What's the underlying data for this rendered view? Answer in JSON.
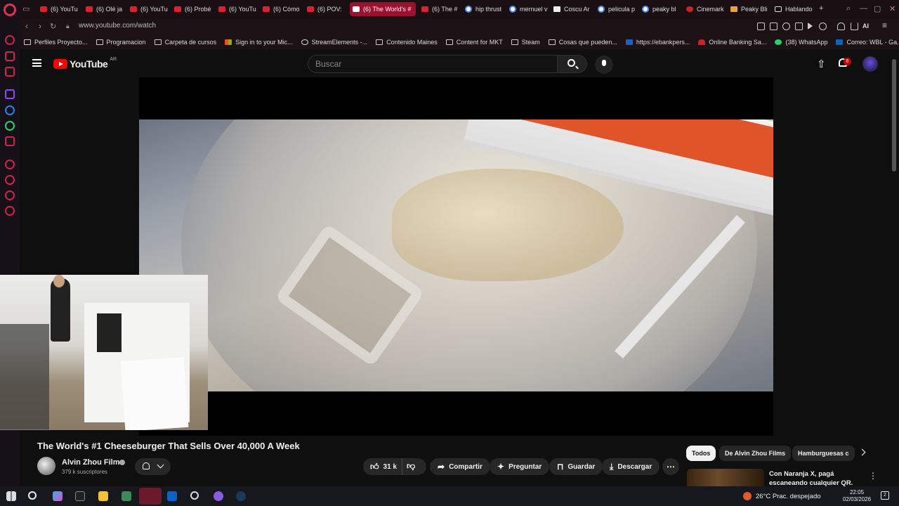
{
  "browser": {
    "tabs": [
      {
        "label": "(6) YouTu",
        "icon": "youtube-icon"
      },
      {
        "label": "(6) Olé ja",
        "icon": "youtube-icon"
      },
      {
        "label": "(6) YouTu",
        "icon": "youtube-icon"
      },
      {
        "label": "(6) Probé",
        "icon": "youtube-icon"
      },
      {
        "label": "(6) YouTu",
        "icon": "youtube-icon"
      },
      {
        "label": "(6) Cómo",
        "icon": "youtube-icon"
      },
      {
        "label": "(6) POV:",
        "icon": "youtube-icon"
      },
      {
        "label": "(6) The World's #",
        "icon": "youtube-icon",
        "active": true
      },
      {
        "label": "(6) The #",
        "icon": "youtube-icon"
      },
      {
        "label": "hip thrust",
        "icon": "google-icon"
      },
      {
        "label": "mernuel v",
        "icon": "google-icon"
      },
      {
        "label": "Coscu Ar",
        "icon": "wikipedia-icon"
      },
      {
        "label": "pelicula p",
        "icon": "google-icon"
      },
      {
        "label": "peaky bl",
        "icon": "google-icon"
      },
      {
        "label": "Cinemark",
        "icon": "cinemark-icon"
      },
      {
        "label": "Peaky Bli",
        "icon": "page-icon"
      },
      {
        "label": "Hablando",
        "icon": "tiktok-icon"
      }
    ],
    "url": "www.youtube.com/watch",
    "bookmarks": [
      "Perfiles Proyecto...",
      "Programacion",
      "Carpeta de cursos",
      "Sign in to your Mic...",
      "StreamElements -...",
      "Contenido Maines",
      "Content for MKT",
      "Steam",
      "Cosas que pueden...",
      "https://ebankpers...",
      "Online Banking Sa...",
      "(38) WhatsApp",
      "Correo: WBL - Ga..."
    ],
    "ai_label": "AI"
  },
  "youtube": {
    "logo_text": "YouTube",
    "country_code": "AR",
    "search_placeholder": "Buscar",
    "notification_count": "6",
    "video": {
      "title": "The World's #1 Cheeseburger That Sells Over 40,000 A Week",
      "channel": "Alvin Zhou Films",
      "subscribers": "379 k suscriptores",
      "likes": "31 k",
      "share_label": "Compartir",
      "ask_label": "Preguntar",
      "save_label": "Guardar",
      "download_label": "Descargar"
    },
    "chips": [
      "Todos",
      "De Alvin Zhou Films",
      "Hamburguesas c"
    ],
    "recommended": {
      "title": "Con Naranja X, pagá escaneando cualquier QR."
    }
  },
  "taskbar": {
    "weather": "26°C  Prac. despejado",
    "time": "22:05",
    "date": "02/03/2026",
    "notifications": "2"
  },
  "colors": {
    "accent": "#ff0000",
    "opera": "#9b1230",
    "background": "#0f0f0f"
  }
}
